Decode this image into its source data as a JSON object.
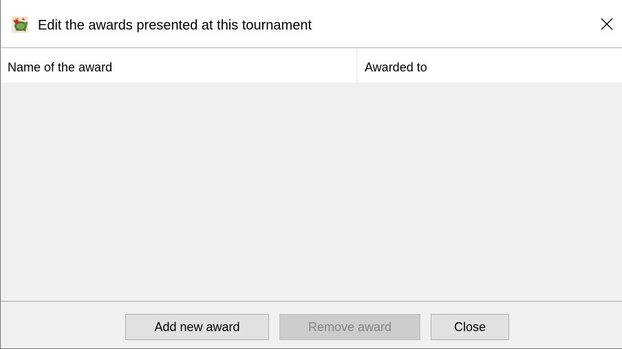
{
  "window": {
    "title": "Edit the awards presented at this tournament",
    "app_icon": "turtle-app-icon",
    "close_icon": "close-icon"
  },
  "table": {
    "columns": [
      {
        "label": "Name of the award"
      },
      {
        "label": "Awarded to"
      }
    ],
    "rows": []
  },
  "buttons": {
    "add_label": "Add new award",
    "remove_label": "Remove award",
    "remove_enabled": false,
    "close_label": "Close"
  },
  "colors": {
    "panel_background": "#f0f0f0",
    "button_background": "#e1e1e1",
    "disabled_button_background": "#cccccc",
    "disabled_text": "#838383"
  }
}
